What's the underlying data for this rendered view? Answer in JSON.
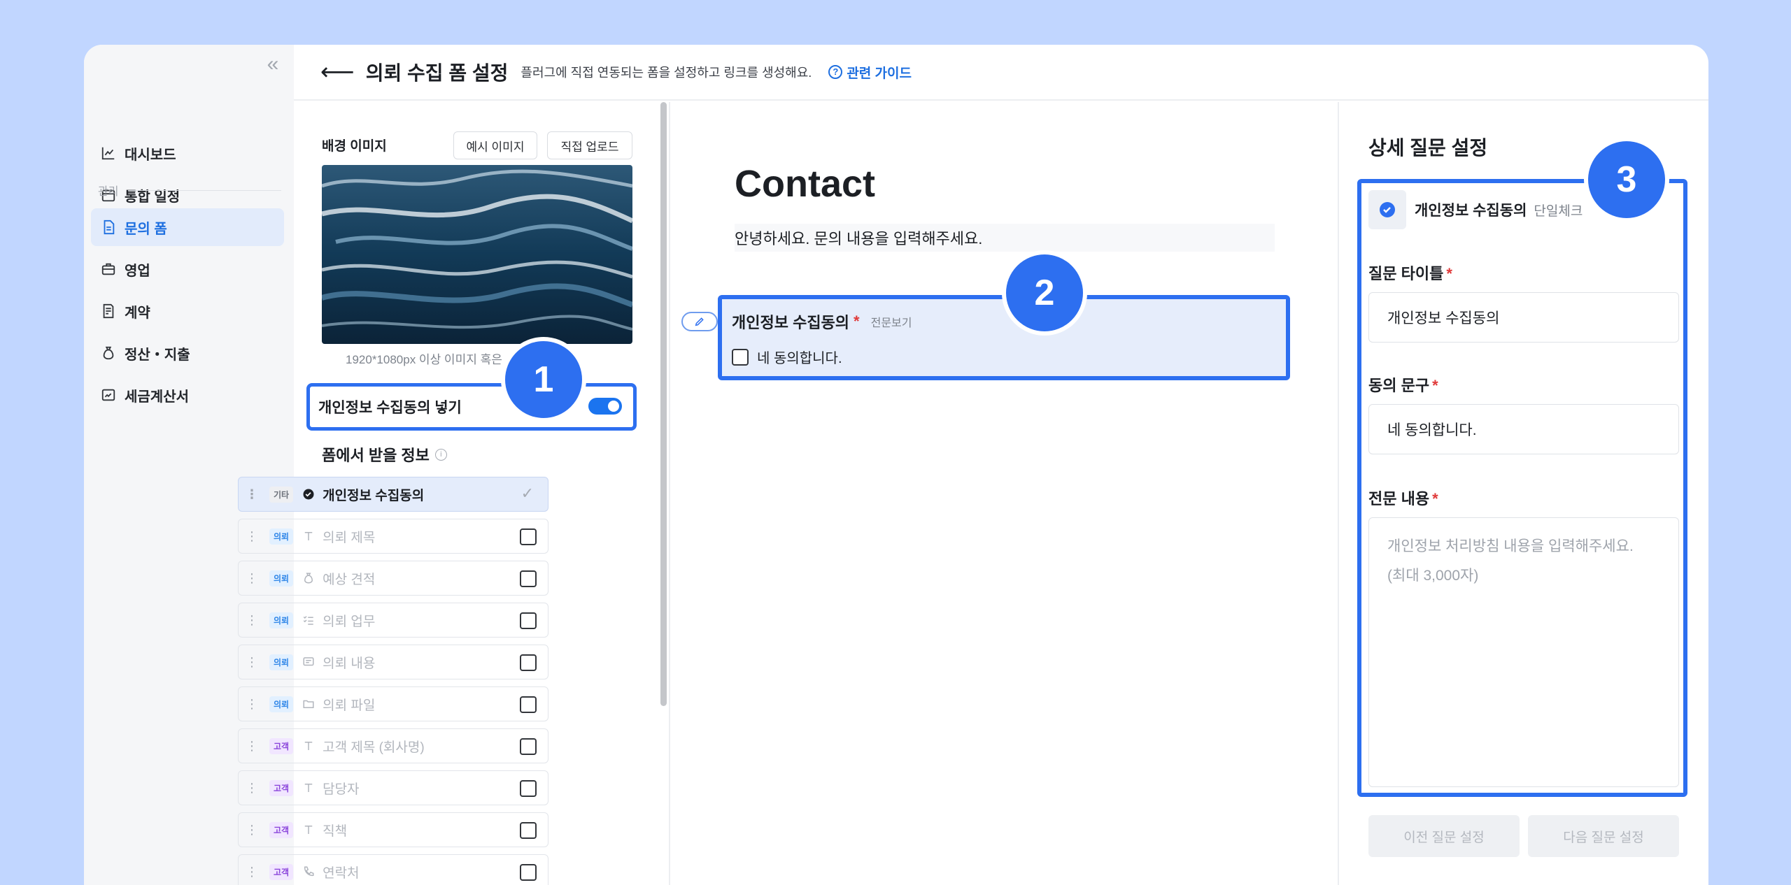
{
  "header": {
    "title": "의뢰 수집 폼 설정",
    "description": "플러그에 직접 연동되는 폼을 설정하고 링크를 생성해요.",
    "guide_link": "관련 가이드"
  },
  "sidebar": {
    "collapse_glyph": "«",
    "items": [
      {
        "label": "대시보드"
      },
      {
        "label": "통합 일정"
      },
      {
        "label": "문의 폼"
      },
      {
        "label": "영업"
      },
      {
        "label": "계약"
      },
      {
        "label": "정산・지출"
      },
      {
        "label": "세금계산서"
      }
    ],
    "section_label": "관리"
  },
  "left_panel": {
    "background_label": "배경 이미지",
    "example_button": "예시 이미지",
    "upload_button": "직접 업로드",
    "image_caption": "1920*1080px 이상 이미지 혹은 ... 주세요.",
    "consent_toggle_label": "개인정보 수집동의 넣기",
    "consent_toggle_on": true,
    "fields_title": "폼에서 받을 정보",
    "fields": [
      {
        "tag": "기타",
        "label": "개인정보 수집동의",
        "checked": true,
        "icon": "check-circle-icon"
      },
      {
        "tag": "의뢰",
        "label": "의뢰 제목",
        "checked": false,
        "icon": "text-icon"
      },
      {
        "tag": "의뢰",
        "label": "예상 견적",
        "checked": false,
        "icon": "money-bag-icon"
      },
      {
        "tag": "의뢰",
        "label": "의뢰 업무",
        "checked": false,
        "icon": "checklist-icon"
      },
      {
        "tag": "의뢰",
        "label": "의뢰 내용",
        "checked": false,
        "icon": "message-icon"
      },
      {
        "tag": "의뢰",
        "label": "의뢰 파일",
        "checked": false,
        "icon": "folder-icon"
      },
      {
        "tag": "고객",
        "label": "고객 제목 (회사명)",
        "checked": false,
        "icon": "text-icon"
      },
      {
        "tag": "고객",
        "label": "담당자",
        "checked": false,
        "icon": "text-icon"
      },
      {
        "tag": "고객",
        "label": "직책",
        "checked": false,
        "icon": "text-icon"
      },
      {
        "tag": "고객",
        "label": "연락처",
        "checked": false,
        "icon": "phone-icon"
      }
    ]
  },
  "preview": {
    "title": "Contact",
    "subtitle": "안녕하세요. 문의 내용을 입력해주세요.",
    "field_title": "개인정보 수집동의",
    "required_mark": "*",
    "full_text_link": "전문보기",
    "checkbox_label": "네 동의합니다."
  },
  "right_panel": {
    "title": "상세 질문 설정",
    "question_name": "개인정보 수집동의",
    "question_type": "단일체크",
    "title_label": "질문 타이틀",
    "title_value": "개인정보 수집동의",
    "consent_label": "동의 문구",
    "consent_value": "네 동의합니다.",
    "content_label": "전문 내용",
    "content_placeholder": "개인정보 처리방침 내용을 입력해주세요.\n(최대 3,000자)",
    "required_mark": "*",
    "prev_button": "이전 질문 설정",
    "next_button": "다음 질문 설정"
  },
  "callouts": [
    "1",
    "2",
    "3"
  ],
  "colors": {
    "accent": "#2d6ff0",
    "link": "#1e6fe0",
    "page_background": "#c1d6ff",
    "required": "#e03a3a"
  }
}
